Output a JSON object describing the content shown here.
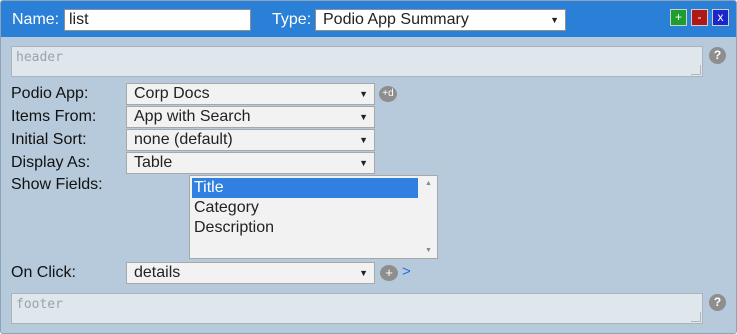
{
  "header": {
    "name_label": "Name:",
    "name_value": "list",
    "type_label": "Type:",
    "type_value": "Podio App Summary",
    "add_button": "+",
    "remove_button": "-",
    "close_button": "x"
  },
  "header_area": {
    "placeholder": "header"
  },
  "help_glyph": "?",
  "fields": {
    "podio_app": {
      "label": "Podio App:",
      "value": "Corp Docs",
      "add_glyph": "+d"
    },
    "items_from": {
      "label": "Items From:",
      "value": "App with Search"
    },
    "initial_sort": {
      "label": "Initial Sort:",
      "value": "none (default)"
    },
    "display_as": {
      "label": "Display As:",
      "value": "Table"
    },
    "show_fields": {
      "label": "Show Fields:",
      "options": [
        "Title",
        "Category",
        "Description"
      ],
      "selected": "Title"
    },
    "on_click": {
      "label": "On Click:",
      "value": "details",
      "add_glyph": "+",
      "link": ">"
    }
  },
  "footer_area": {
    "placeholder": "footer"
  },
  "colors": {
    "accent": "#2a7fd6",
    "panel": "#b7cadb",
    "add": "#1e9e2e",
    "remove": "#b01818",
    "close": "#1c27c9"
  },
  "icons": [
    "help-icon",
    "add-icon",
    "remove-icon",
    "close-icon",
    "chevron-down-icon"
  ]
}
